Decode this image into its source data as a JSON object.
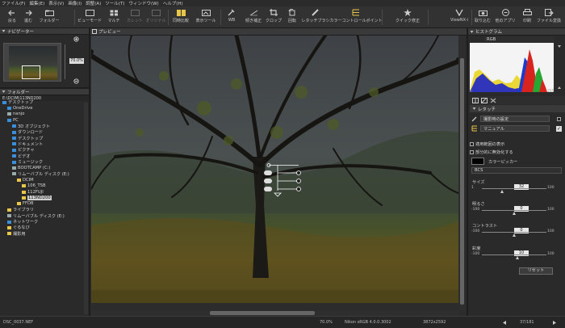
{
  "menubar": [
    "ファイル(F)",
    "編集(E)",
    "表示(V)",
    "画像(I)",
    "調整(A)",
    "ツール(T)",
    "ウィンドウ(W)",
    "ヘルプ(H)"
  ],
  "toolbar": {
    "back": "戻る",
    "forward": "進む",
    "folder": "フォルダー",
    "viewer_mode": "ビューモード",
    "multi": "マルチ",
    "current": "カレント",
    "original": "オリジナル",
    "compare": "同時比較",
    "display_tool": "表示ツール",
    "wb": "WB",
    "straighten": "傾き補正",
    "crop": "クロップ",
    "rotate": "回転",
    "retouch_brush": "レタッチブラシ",
    "color_control_point": "カラーコントロールポイント",
    "quick_fix": "クイック修正",
    "viewnx": "ViewNX-i",
    "import": "取り込む",
    "other_apps": "他のアプリ",
    "print": "印刷",
    "file_convert": "ファイル変換"
  },
  "navigator": {
    "title": "ナビゲーター",
    "zoom": "70.0%"
  },
  "folder_panel": {
    "title": "フォルダー",
    "path": "E:\\DCIM\\113ND200"
  },
  "tree": [
    {
      "label": "デスクトップ",
      "indent": 0,
      "icon": "folder-blue",
      "selected": false
    },
    {
      "label": "OneDrive",
      "indent": 1,
      "icon": "folder-blue",
      "selected": false
    },
    {
      "label": "nanjo",
      "indent": 1,
      "icon": "folder-gray",
      "selected": false
    },
    {
      "label": "PC",
      "indent": 1,
      "icon": "folder-blue",
      "selected": false
    },
    {
      "label": "3D オブジェクト",
      "indent": 2,
      "icon": "folder-blue",
      "selected": false
    },
    {
      "label": "ダウンロード",
      "indent": 2,
      "icon": "folder-blue",
      "selected": false
    },
    {
      "label": "デスクトップ",
      "indent": 2,
      "icon": "folder-blue",
      "selected": false
    },
    {
      "label": "ドキュメント",
      "indent": 2,
      "icon": "folder-blue",
      "selected": false
    },
    {
      "label": "ピクチャ",
      "indent": 2,
      "icon": "folder-blue",
      "selected": false
    },
    {
      "label": "ビデオ",
      "indent": 2,
      "icon": "folder-blue",
      "selected": false
    },
    {
      "label": "ミュージック",
      "indent": 2,
      "icon": "folder-blue",
      "selected": false
    },
    {
      "label": "BOOTCAMP (C:)",
      "indent": 2,
      "icon": "folder-gray",
      "selected": false
    },
    {
      "label": "リムーバブル ディスク (E:)",
      "indent": 2,
      "icon": "folder-gray",
      "selected": false
    },
    {
      "label": "DCIM",
      "indent": 3,
      "icon": "folder-yellow",
      "selected": false
    },
    {
      "label": "106_TSB",
      "indent": 4,
      "icon": "folder-yellow",
      "selected": false
    },
    {
      "label": "112FUJI",
      "indent": 4,
      "icon": "folder-yellow",
      "selected": false
    },
    {
      "label": "113ND200",
      "indent": 4,
      "icon": "folder-yellow",
      "selected": true
    },
    {
      "label": "FFDB",
      "indent": 3,
      "icon": "folder-yellow",
      "selected": false
    },
    {
      "label": "ライブラリ",
      "indent": 1,
      "icon": "folder-yellow",
      "selected": false
    },
    {
      "label": "リムーバブル ディスク (E:)",
      "indent": 1,
      "icon": "folder-gray",
      "selected": false
    },
    {
      "label": "ネットワーク",
      "indent": 1,
      "icon": "folder-blue",
      "selected": false
    },
    {
      "label": "ぐるなび",
      "indent": 1,
      "icon": "folder-yellow",
      "selected": false
    },
    {
      "label": "撮影用",
      "indent": 1,
      "icon": "folder-yellow",
      "selected": false
    }
  ],
  "preview": {
    "title": "プレビュー"
  },
  "histogram": {
    "title": "ヒストグラム",
    "channel": "RGB",
    "min": "0",
    "max": "255"
  },
  "retouch": {
    "title": "レタッチ",
    "preset": "撮影時の設定",
    "mode": "マニュアル",
    "show_adjusted": "適用範囲の表示",
    "disable_partial": "部分的に無効化する",
    "color_picker": "カラーピッカー",
    "bcs": "BCS",
    "reset": "リセット"
  },
  "sliders": [
    {
      "label": "サイズ",
      "min": "1",
      "max": "100",
      "value": 32
    },
    {
      "label": "明るさ",
      "min": "-100",
      "max": "100",
      "value": 0
    },
    {
      "label": "コントラスト",
      "min": "-100",
      "max": "100",
      "value": 0
    },
    {
      "label": "彩度",
      "min": "-100",
      "max": "100",
      "value": 10
    }
  ],
  "status": {
    "filename": "DSC_0037.NEF",
    "zoom": "70.0%",
    "camera": "Nikon sRGB 4.0.0.3002",
    "dimensions": "3872x2592",
    "counter": "37/181"
  }
}
